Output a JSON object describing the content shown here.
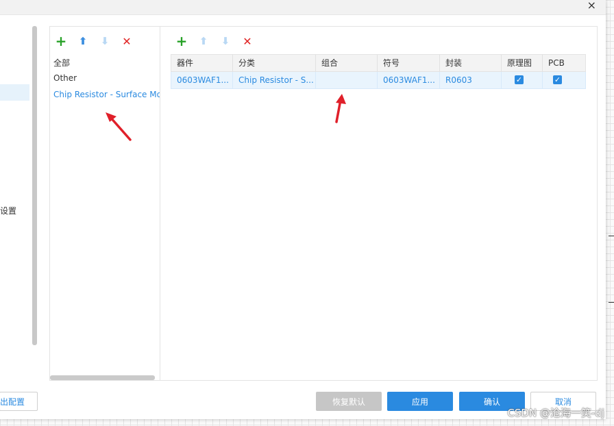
{
  "dialog": {
    "close_label": "×"
  },
  "left_pane": {
    "truncated_label": "设置"
  },
  "category_toolbar": {
    "add": "+",
    "up": "⬆",
    "down": "⬇",
    "delete": "✕"
  },
  "categories": [
    {
      "label": "全部",
      "selected": false
    },
    {
      "label": "Other",
      "selected": false
    },
    {
      "label": "Chip Resistor - Surface Mount",
      "selected": true
    }
  ],
  "grid_toolbar": {
    "add": "+",
    "up": "⬆",
    "down": "⬇",
    "delete": "✕"
  },
  "grid": {
    "columns": [
      "器件",
      "分类",
      "组合",
      "符号",
      "封装",
      "原理图",
      "PCB"
    ],
    "rows": [
      {
        "device": "0603WAF1...",
        "category": "Chip Resistor - S...",
        "group": "",
        "symbol": "0603WAF1...",
        "footprint": "R0603",
        "schematic": true,
        "pcb": true
      }
    ]
  },
  "buttons": {
    "export": "出配置",
    "restore": "恢复默认",
    "apply": "应用",
    "ok": "确认",
    "cancel": "取消"
  },
  "credit": "CSDN @沧海一笑-dj",
  "colors": {
    "accent": "#2a8ae0",
    "add_green": "#27a127",
    "delete_red": "#e02424",
    "selection_bg": "#e9f4fd",
    "annotation_arrow": "#e0202a"
  }
}
